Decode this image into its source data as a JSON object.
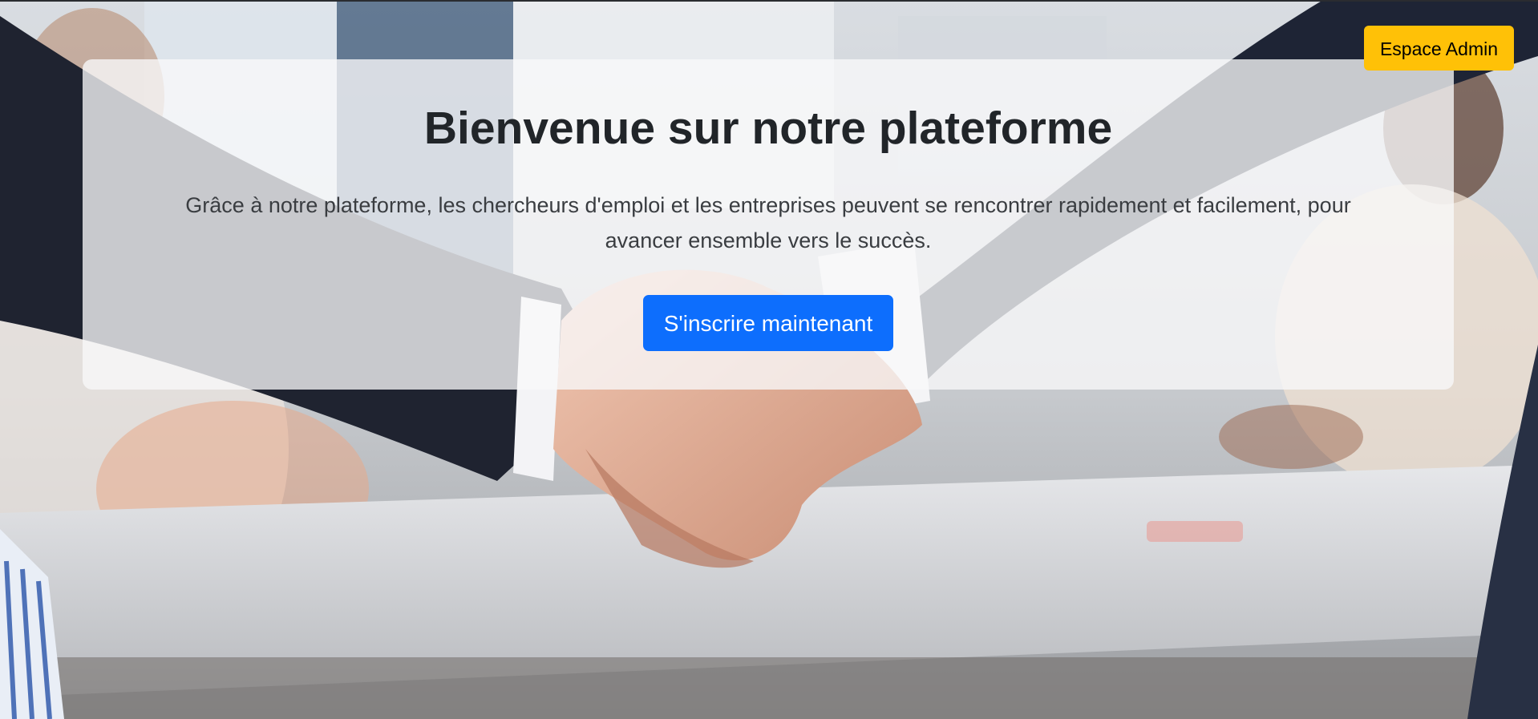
{
  "header": {
    "admin_label": "Espace Admin"
  },
  "hero": {
    "title": "Bienvenue sur notre plateforme",
    "lead": "Grâce à notre plateforme, les chercheurs d'emploi et les entreprises peuvent se rencontrer rapidement et facilement, pour avancer ensemble vers le succès.",
    "cta_label": "S'inscrire maintenant",
    "background_image": "handshake-photo"
  },
  "colors": {
    "admin_button": "#ffc107",
    "cta_button": "#0d6efd",
    "card_background": "#f8f9fa",
    "title_text": "#212529"
  }
}
